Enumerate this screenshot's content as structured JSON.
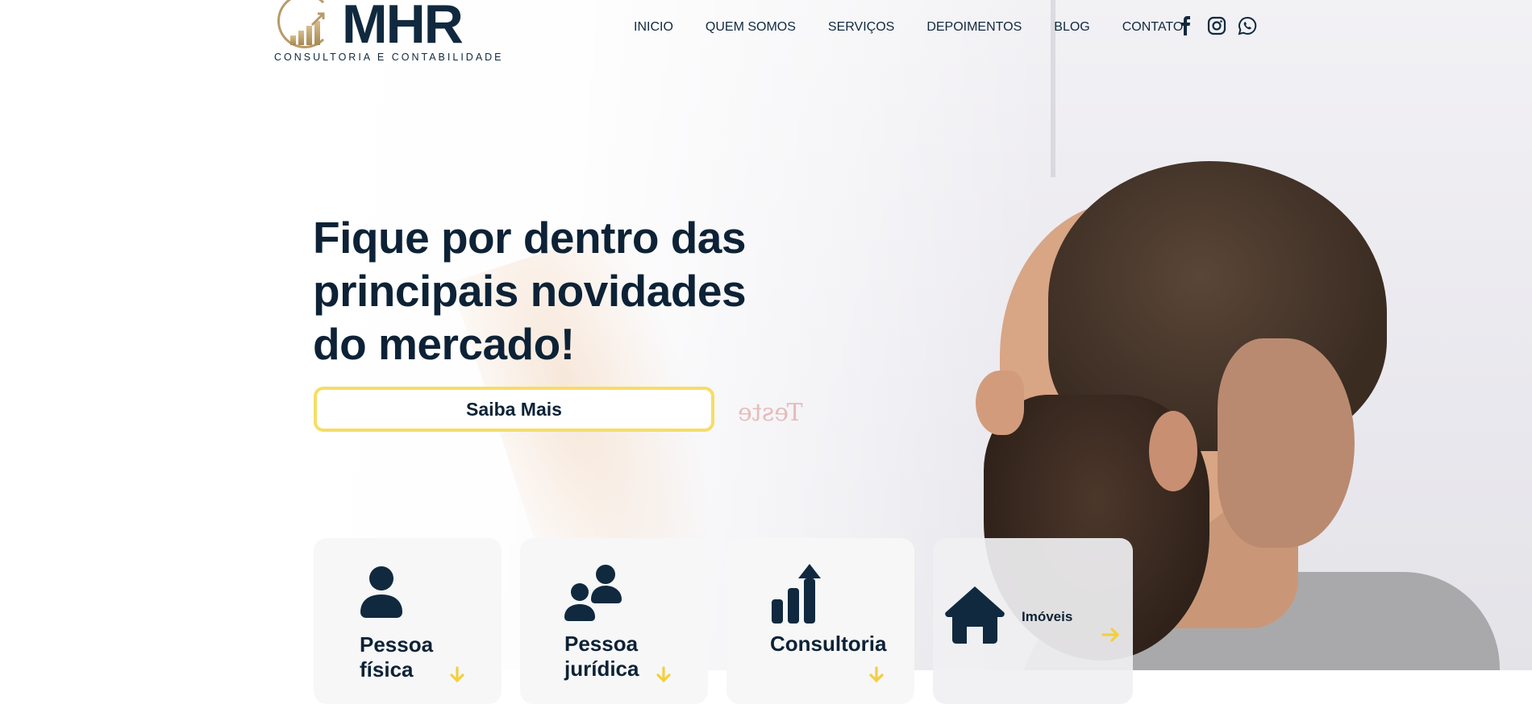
{
  "brand": {
    "name": "MHR",
    "tagline": "CONSULTORIA E CONTABILIDADE"
  },
  "nav": {
    "items": [
      {
        "label": "INICIO"
      },
      {
        "label": "QUEM SOMOS"
      },
      {
        "label": "SERVIÇOS"
      },
      {
        "label": "DEPOIMENTOS"
      },
      {
        "label": "BLOG"
      },
      {
        "label": "CONTATO"
      }
    ],
    "social": [
      "facebook-icon",
      "instagram-icon",
      "whatsapp-icon"
    ]
  },
  "hero": {
    "headline_line1": "Fique por dentro das",
    "headline_line2": "principais novidades",
    "headline_line3": "do mercado!",
    "cta_label": "Saiba Mais",
    "board_text": "Teste"
  },
  "cards": [
    {
      "title_line1": "Pessoa",
      "title_line2": "física",
      "icon": "person-icon"
    },
    {
      "title_line1": "Pessoa",
      "title_line2": "jurídica",
      "icon": "people-icon"
    },
    {
      "title_line1": "Consultoria",
      "title_line2": "",
      "icon": "chart-growth-icon"
    },
    {
      "title_line1": "Imóveis",
      "title_line2": "",
      "icon": "house-icon"
    }
  ],
  "colors": {
    "navy": "#0d2236",
    "accent_yellow": "#f6dd66",
    "gold": "#b89a6a"
  }
}
